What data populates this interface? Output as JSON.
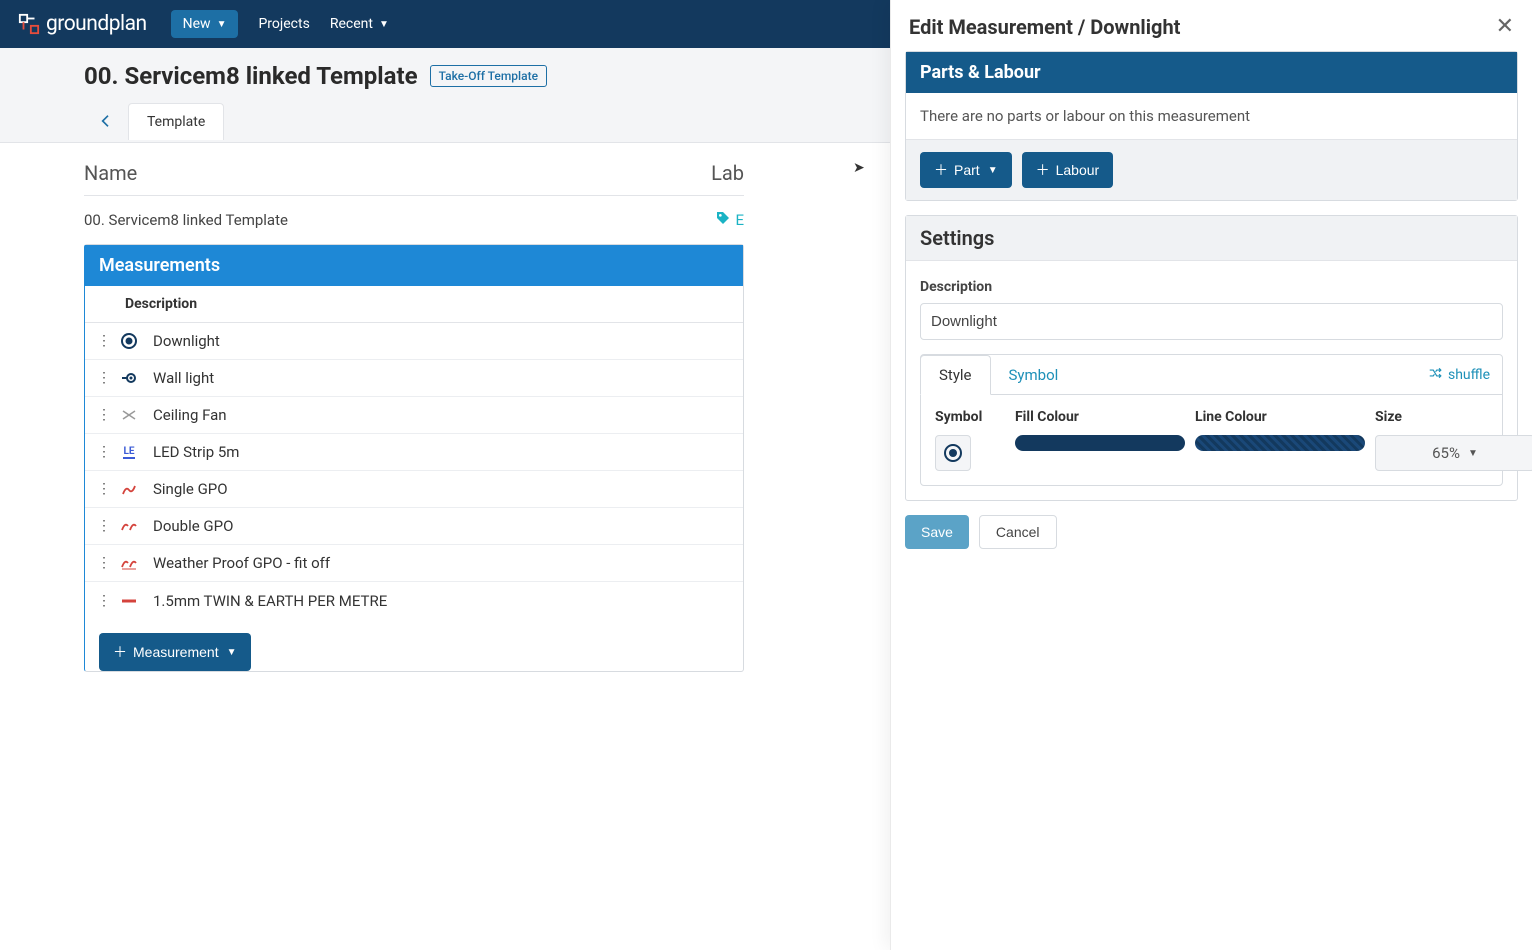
{
  "brand": "groundplan",
  "nav": {
    "new_label": "New",
    "projects_label": "Projects",
    "recent_label": "Recent"
  },
  "page": {
    "title": "00. Servicem8 linked Template",
    "badge": "Take-Off Template",
    "tab_template": "Template"
  },
  "columns": {
    "name": "Name",
    "labour_short": "Lab"
  },
  "template_row": {
    "name": "00. Servicem8 linked Template",
    "edit_label": "E"
  },
  "measurements": {
    "header": "Measurements",
    "col_desc": "Description",
    "items": [
      {
        "desc": "Downlight",
        "icon": "downlight"
      },
      {
        "desc": "Wall light",
        "icon": "walllight"
      },
      {
        "desc": "Ceiling Fan",
        "icon": "fan"
      },
      {
        "desc": "LED Strip 5m",
        "icon": "led"
      },
      {
        "desc": "Single GPO",
        "icon": "gpo1"
      },
      {
        "desc": "Double GPO",
        "icon": "gpo2"
      },
      {
        "desc": "Weather Proof GPO - fit off",
        "icon": "gpo3"
      },
      {
        "desc": "1.5mm TWIN & EARTH PER METRE",
        "icon": "line"
      }
    ],
    "add_label": "Measurement"
  },
  "panel": {
    "title": "Edit Measurement / Downlight",
    "parts": {
      "header": "Parts & Labour",
      "empty": "There are no parts or labour on this measurement",
      "part_label": "Part",
      "labour_label": "Labour"
    },
    "settings": {
      "header": "Settings",
      "desc_label": "Description",
      "desc_value": "Downlight",
      "tab_style": "Style",
      "tab_symbol": "Symbol",
      "shuffle": "shuffle",
      "lbl_symbol": "Symbol",
      "lbl_fill": "Fill Colour",
      "lbl_line": "Line Colour",
      "lbl_size": "Size",
      "size_value": "65%",
      "fill_colour": "#13395e",
      "line_colour": "#13395e"
    },
    "save": "Save",
    "cancel": "Cancel"
  }
}
